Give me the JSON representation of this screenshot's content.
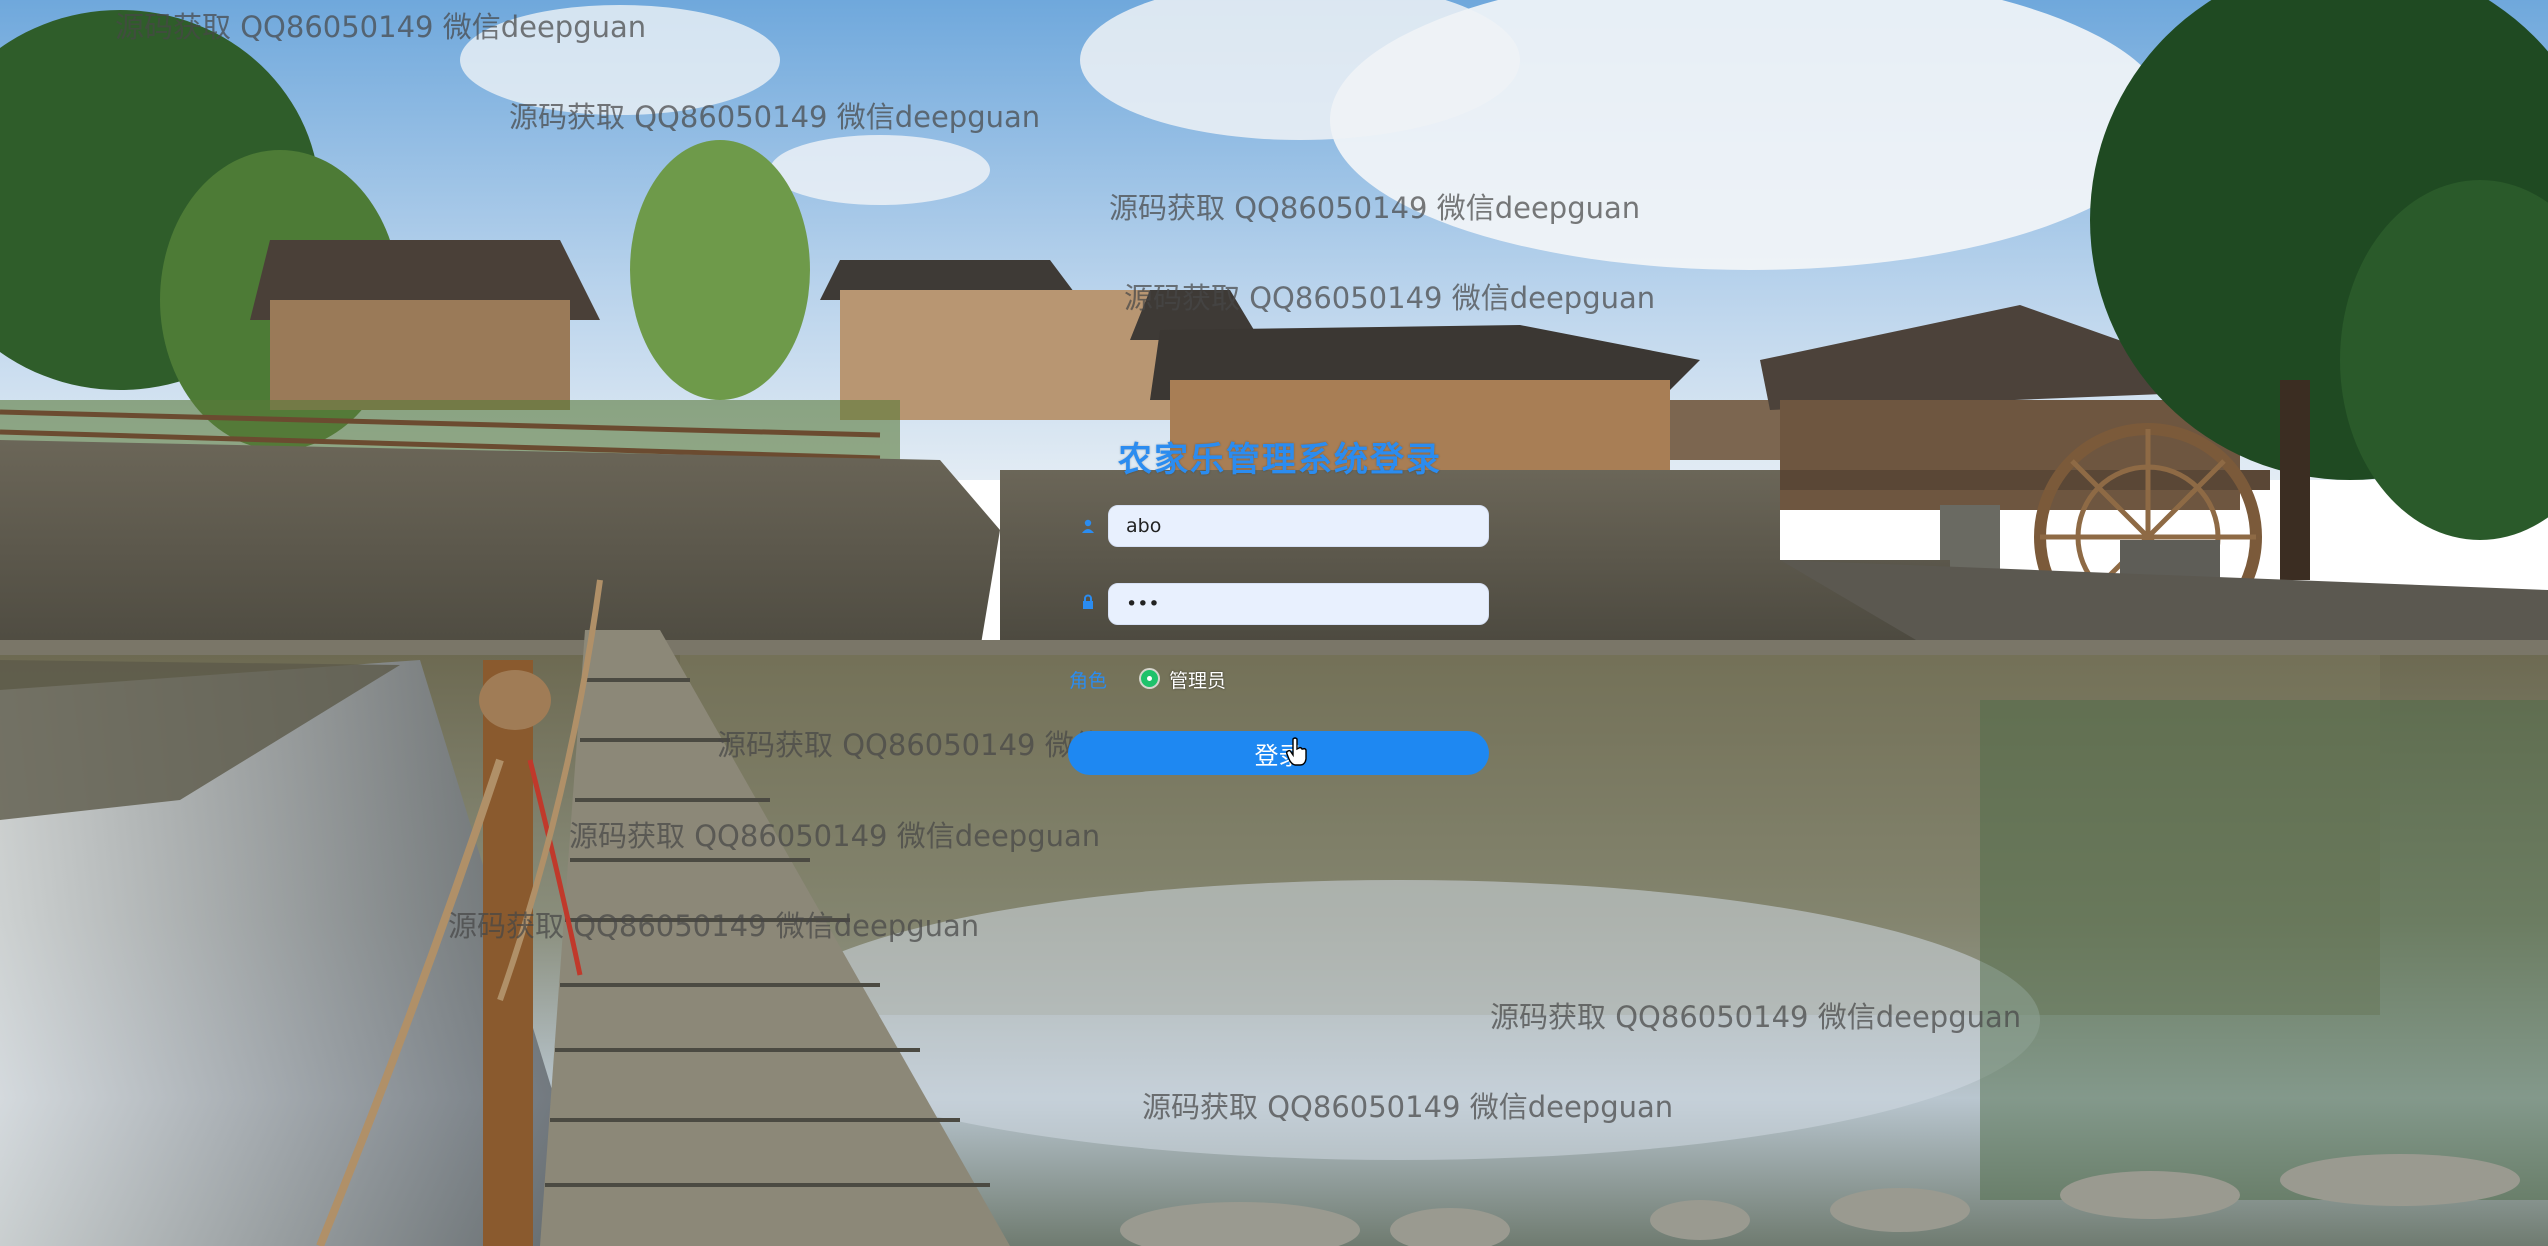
{
  "login": {
    "title": "农家乐管理系统登录",
    "username": {
      "value": "abo",
      "icon": "user-icon"
    },
    "password": {
      "value": "•••",
      "icon": "lock-icon"
    },
    "role": {
      "label": "角色",
      "selected": "管理员"
    },
    "submit_label": "登录"
  },
  "watermarks": [
    "源码获取 QQ86050149 微信deepguan",
    "源码获取 QQ86050149 微信deepguan",
    "源码获取 QQ86050149 微信deepguan",
    "源码获取 QQ86050149 微信deepguan",
    "源码获取 QQ86050149 微信deepguan",
    "源码获取 QQ86050149 微信deepguan",
    "源码获取 QQ86050149 微信deepguan",
    "源码获取 QQ86050149 微信deepguan",
    "源码获取 QQ86050149 微信deepguan"
  ],
  "colors": {
    "accent": "#1e88f2",
    "title": "#2b8cf0",
    "radio": "#1fc26b",
    "input_bg": "#e8f0fe"
  }
}
